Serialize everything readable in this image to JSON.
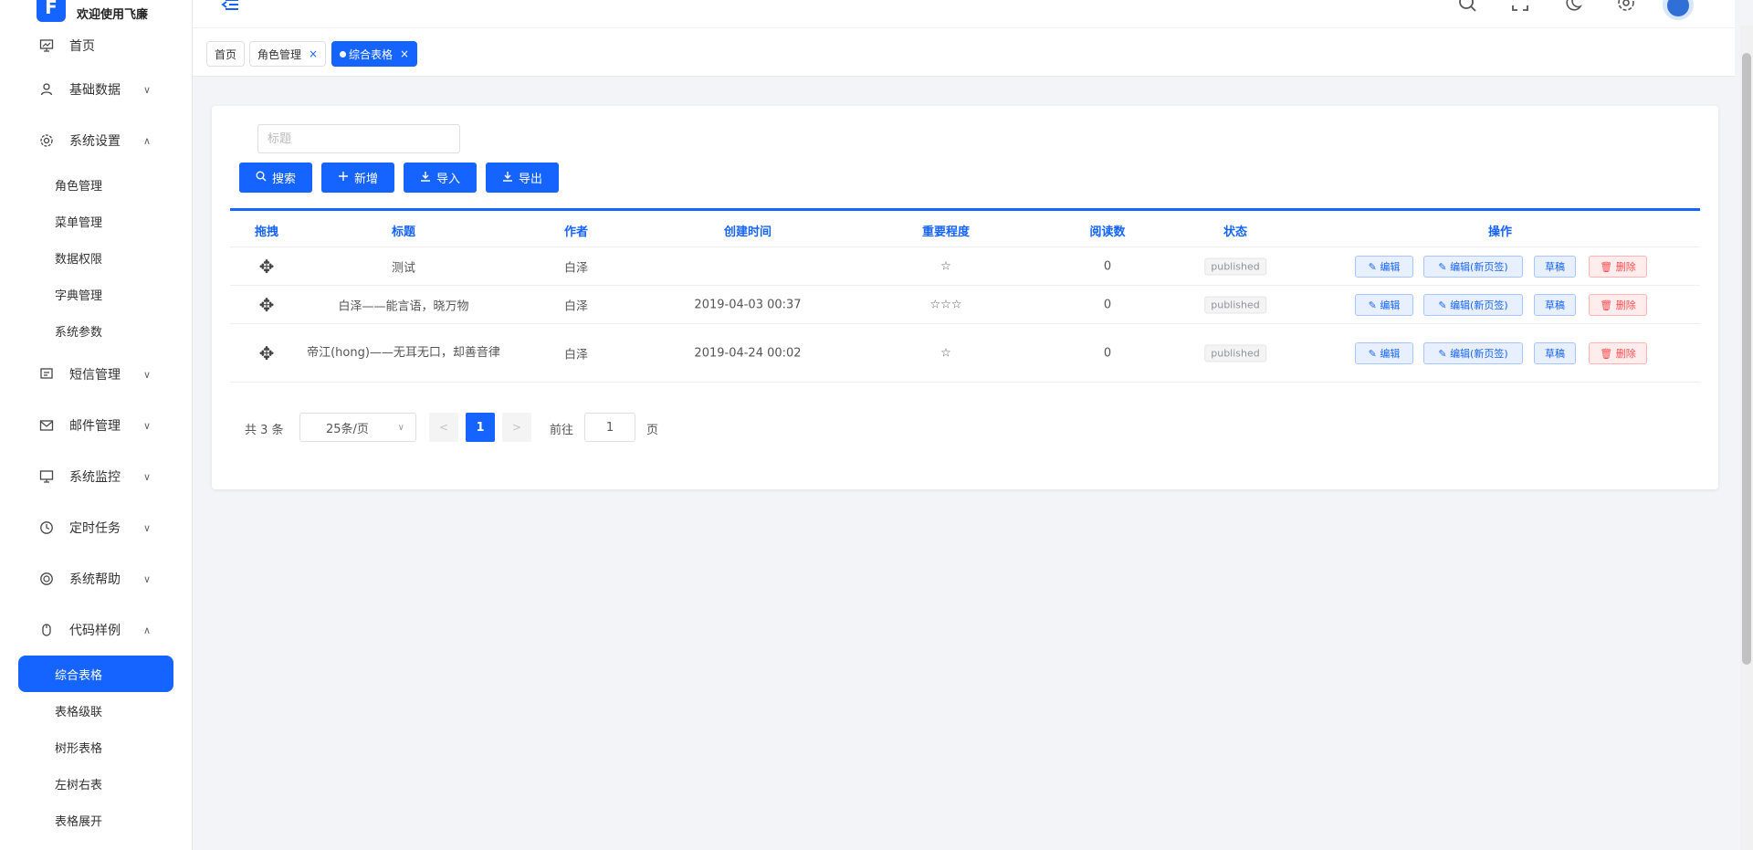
{
  "app": {
    "logo_letter": "F",
    "title": "欢迎使用飞廉"
  },
  "sidebar": {
    "items": [
      {
        "label": "首页",
        "icon": "chart-icon"
      },
      {
        "label": "基础数据",
        "icon": "user-icon",
        "chevron": "∨"
      },
      {
        "label": "系统设置",
        "icon": "gear-icon",
        "chevron": "∧"
      },
      {
        "label": "短信管理",
        "icon": "message-icon",
        "chevron": "∨"
      },
      {
        "label": "邮件管理",
        "icon": "mail-icon",
        "chevron": "∨"
      },
      {
        "label": "系统监控",
        "icon": "monitor-icon",
        "chevron": "∨"
      },
      {
        "label": "定时任务",
        "icon": "clock-icon",
        "chevron": "∨"
      },
      {
        "label": "系统帮助",
        "icon": "help-icon",
        "chevron": "∨"
      },
      {
        "label": "代码样例",
        "icon": "mouse-icon",
        "chevron": "∧"
      }
    ],
    "settings_sub": [
      "角色管理",
      "菜单管理",
      "数据权限",
      "字典管理",
      "系统参数"
    ],
    "code_sub": [
      "综合表格",
      "表格级联",
      "树形表格",
      "左树右表",
      "表格展开"
    ]
  },
  "tabs": [
    {
      "label": "首页"
    },
    {
      "label": "角色管理",
      "close": "×"
    },
    {
      "label": "综合表格",
      "close": "×"
    }
  ],
  "search": {
    "placeholder": "标题"
  },
  "toolbar": {
    "search_label": "搜索",
    "add_label": "新增",
    "import_label": "导入",
    "export_label": "导出"
  },
  "table": {
    "columns": [
      "拖拽",
      "标题",
      "作者",
      "创建时间",
      "重要程度",
      "阅读数",
      "状态",
      "操作"
    ],
    "rows": [
      {
        "title": "测试",
        "author": "白泽",
        "created": "",
        "importance": "☆",
        "reads": "0",
        "status": "published"
      },
      {
        "title": "白泽——能言语，晓万物",
        "author": "白泽",
        "created": "2019-04-03 00:37",
        "importance": "☆☆☆",
        "reads": "0",
        "status": "published"
      },
      {
        "title": "帝江(hong)——无耳无口，却善音律",
        "author": "白泽",
        "created": "2019-04-24 00:02",
        "importance": "☆",
        "reads": "0",
        "status": "published"
      }
    ],
    "actions": {
      "edit": "编辑",
      "edit_new": "编辑(新页签)",
      "draft": "草稿",
      "delete": "删除"
    }
  },
  "pagination": {
    "total": "共 3 条",
    "page_size": "25条/页",
    "current": "1",
    "goto_label": "前往",
    "goto_value": "1",
    "page_suffix": "页"
  },
  "colors": {
    "primary": "#1664ff",
    "danger": "#ff4d4f"
  }
}
